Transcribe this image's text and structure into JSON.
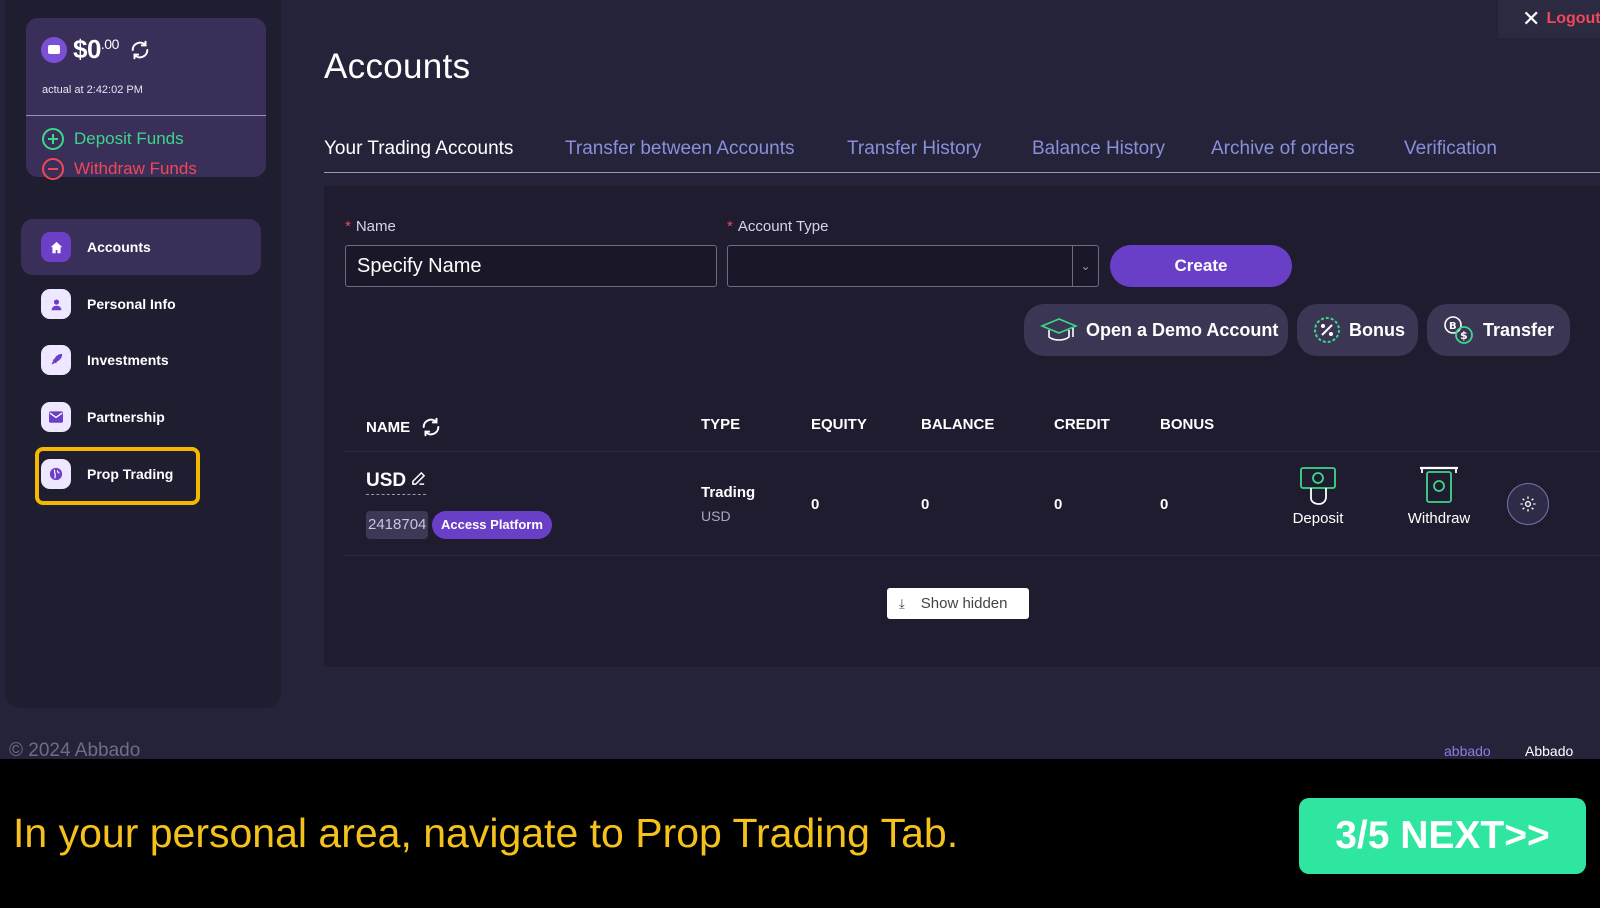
{
  "wallet": {
    "amount": "$0",
    "cents": ".00",
    "actual": "actual at 2:42:02 PM",
    "deposit_label": "Deposit Funds",
    "withdraw_label": "Withdraw Funds"
  },
  "sidebar": {
    "items": [
      {
        "label": "Accounts",
        "icon": "home-icon"
      },
      {
        "label": "Personal Info",
        "icon": "user-icon"
      },
      {
        "label": "Investments",
        "icon": "rocket-icon"
      },
      {
        "label": "Partnership",
        "icon": "envelope-icon"
      },
      {
        "label": "Prop Trading",
        "icon": "globe-icon"
      }
    ]
  },
  "header": {
    "title": "Accounts",
    "logout": "Logout"
  },
  "tabs": [
    "Your Trading Accounts",
    "Transfer between Accounts",
    "Transfer History",
    "Balance History",
    "Archive of orders",
    "Verification"
  ],
  "form": {
    "name_label": "Name",
    "name_value": "Specify Name",
    "type_label": "Account Type",
    "type_value": "",
    "create_label": "Create"
  },
  "actions": {
    "demo": "Open a Demo Account",
    "bonus": "Bonus",
    "transfer": "Transfer"
  },
  "table": {
    "headers": [
      "NAME",
      "TYPE",
      "EQUITY",
      "BALANCE",
      "CREDIT",
      "BONUS"
    ],
    "rows": [
      {
        "name": "USD",
        "number": "2418704",
        "access": "Access Platform",
        "type": "Trading",
        "currency": "USD",
        "equity": "0",
        "balance": "0",
        "credit": "0",
        "bonus": "0",
        "deposit": "Deposit",
        "withdraw": "Withdraw"
      }
    ],
    "show_hidden": "Show hidden"
  },
  "footer": {
    "copyright": "© 2024 Abbado",
    "link1": "abbado",
    "link2": "Abbado"
  },
  "caption": {
    "text": "In your personal area, navigate to Prop Trading Tab.",
    "next": "3/5 NEXT>>"
  },
  "colors": {
    "accent": "#6a3fc8",
    "highlight": "#f5b800",
    "positive": "#3dd68c",
    "negative": "#f0485a",
    "next": "#2ee6a0"
  }
}
